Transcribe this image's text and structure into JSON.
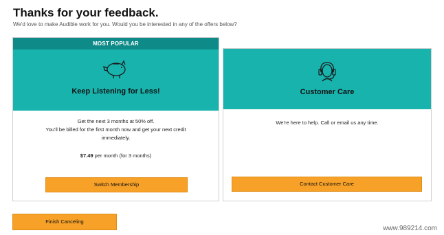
{
  "page": {
    "title": "Thanks for your feedback.",
    "subtitle": "We'd love to make Audible work for you. Would you be interested in any of the offers below?"
  },
  "offers": [
    {
      "badge": "MOST POPULAR",
      "icon": "piggy-bank-icon",
      "title": "Keep Listening for Less!",
      "desc_line1": "Get the next 3 months at 50% off.",
      "desc_line2": "You'll be billed for the first month now and get your next credit",
      "desc_line3": "immediately.",
      "price": "$7.49",
      "price_suffix": " per month (for 3 months)",
      "button": "Switch Membership"
    },
    {
      "icon": "headset-icon",
      "title": "Customer Care",
      "desc": "We're here to help. Call or email us any time.",
      "button": "Contact Customer Care"
    }
  ],
  "footer": {
    "finish_button": "Finish Canceling"
  },
  "watermark": "www.989214.com",
  "colors": {
    "teal": "#18b3ad",
    "teal_dark": "#0e8b88",
    "orange": "#f7a128"
  }
}
